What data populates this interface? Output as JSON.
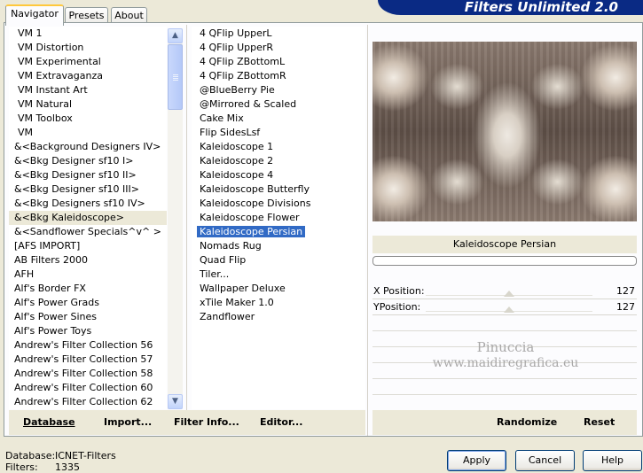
{
  "tabs": [
    {
      "label": "Navigator"
    },
    {
      "label": "Presets"
    },
    {
      "label": "About"
    }
  ],
  "banner": {
    "title": "Filters Unlimited 2.0"
  },
  "categories": [
    "VM 1",
    "VM Distortion",
    "VM Experimental",
    "VM Extravaganza",
    "VM Instant Art",
    "VM Natural",
    "VM Toolbox",
    "VM",
    "&<Background Designers IV>",
    "&<Bkg Designer sf10 I>",
    "&<Bkg Designer sf10 II>",
    "&<Bkg Designer sf10 III>",
    "&<Bkg Designers sf10 IV>",
    "&<Bkg Kaleidoscope>",
    "&<Sandflower Specials^v^ >",
    "[AFS IMPORT]",
    "AB Filters 2000",
    "AFH",
    "Alf's Border FX",
    "Alf's Power Grads",
    "Alf's Power Sines",
    "Alf's Power Toys",
    "Andrew's Filter Collection 56",
    "Andrew's Filter Collection 57",
    "Andrew's Filter Collection 58",
    "Andrew's Filter Collection 60",
    "Andrew's Filter Collection 62"
  ],
  "selected_category": "&<Bkg Kaleidoscope>",
  "filters": [
    "4 QFlip UpperL",
    "4 QFlip UpperR",
    "4 QFlip ZBottomL",
    "4 QFlip ZBottomR",
    "@BlueBerry Pie",
    "@Mirrored & Scaled",
    "Cake Mix",
    "Flip SidesLsf",
    "Kaleidoscope 1",
    "Kaleidoscope 2",
    "Kaleidoscope 4",
    "Kaleidoscope Butterfly",
    "Kaleidoscope Divisions",
    "Kaleidoscope Flower",
    "Kaleidoscope Persian",
    "Nomads Rug",
    "Quad Flip",
    "Tiler...",
    "Wallpaper Deluxe",
    "xTile Maker 1.0",
    "Zandflower"
  ],
  "selected_filter": "Kaleidoscope Persian",
  "commands": {
    "database": "Database",
    "import": "Import...",
    "filter_info": "Filter Info...",
    "editor": "Editor..."
  },
  "preview": {
    "filter_name": "Kaleidoscope Persian"
  },
  "params": [
    {
      "label": "X Position:",
      "value": "127",
      "fraction": 0.5
    },
    {
      "label": "YPosition:",
      "value": "127",
      "fraction": 0.5
    }
  ],
  "watermark": {
    "line1": "Pinuccia",
    "line2": "www.maidiregrafica.eu"
  },
  "right_commands": {
    "randomize": "Randomize",
    "reset": "Reset"
  },
  "status": {
    "database_label": "Database:",
    "database_value": "ICNET-Filters",
    "filters_label": "Filters:",
    "filters_value": "1335"
  },
  "buttons": {
    "apply": "Apply",
    "cancel": "Cancel",
    "help": "Help"
  }
}
